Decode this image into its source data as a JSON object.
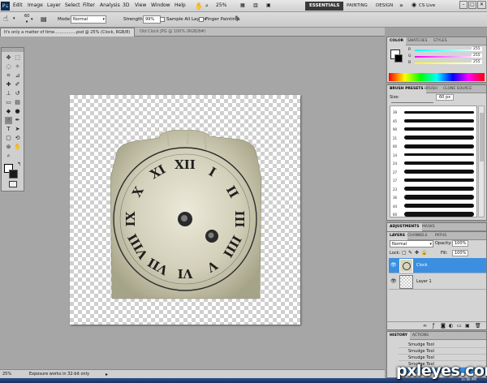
{
  "menu": {
    "items": [
      "File",
      "Edit",
      "Image",
      "Layer",
      "Select",
      "Filter",
      "Analysis",
      "3D",
      "View",
      "Window",
      "Help"
    ],
    "zoom": "25%",
    "workspaces": [
      "ESSENTIALS",
      "PAINTING",
      "DESIGN"
    ],
    "cs_live": "CS Live"
  },
  "options": {
    "mode_label": "Mode:",
    "mode_value": "Normal",
    "strength_label": "Strength:",
    "strength_value": "99%",
    "sample_all_layers": "Sample All Layers",
    "finger_painting": "Finger Painting",
    "brush_size": "60"
  },
  "tabs": [
    {
      "label": "It's only a matter of time.................psd @ 25% (Clock, RGB/8)"
    },
    {
      "label": "Old Clock JPG @ 100% (RGB/8#)"
    }
  ],
  "color_panel": {
    "tabs": [
      "COLOR",
      "SWATCHES",
      "STYLES"
    ],
    "r_label": "R",
    "r_value": "255",
    "g_label": "G",
    "g_value": "255",
    "b_label": "B",
    "b_value": "255"
  },
  "brush_panel": {
    "tabs": [
      "BRUSH PRESETS",
      "BRUSH",
      "CLONE SOURCE"
    ],
    "size_label": "Size:",
    "size_value": "60 px",
    "presets": [
      "39",
      "45",
      "90",
      "21",
      "60",
      "14",
      "24",
      "27",
      "17",
      "23",
      "36",
      "44",
      "60"
    ]
  },
  "adjustments": {
    "tabs": [
      "ADJUSTMENTS",
      "MASKS"
    ]
  },
  "layers_panel": {
    "tabs": [
      "LAYERS",
      "CHANNELS",
      "PATHS"
    ],
    "blend": "Normal",
    "opacity_label": "Opacity:",
    "opacity_value": "100%",
    "lock_label": "Lock:",
    "fill_label": "Fill:",
    "fill_value": "100%",
    "layers": [
      {
        "name": "Clock",
        "selected": true
      },
      {
        "name": "Layer 1",
        "selected": false
      }
    ]
  },
  "history_panel": {
    "tabs": [
      "HISTORY",
      "ACTIONS"
    ],
    "items": [
      "Smudge Tool",
      "Smudge Tool",
      "Smudge Tool",
      "Smudge Tool",
      "Smudge Tool"
    ]
  },
  "status": {
    "zoom": "25%",
    "message": "Exposure works in 32-bit only"
  },
  "clock": {
    "numerals": [
      "XII",
      "I",
      "II",
      "III",
      "IIII",
      "V",
      "VI",
      "VII",
      "VIII",
      "IX",
      "X",
      "XI"
    ]
  },
  "watermark": "pxleyes.com",
  "taskbar_time": "11:00 PM"
}
